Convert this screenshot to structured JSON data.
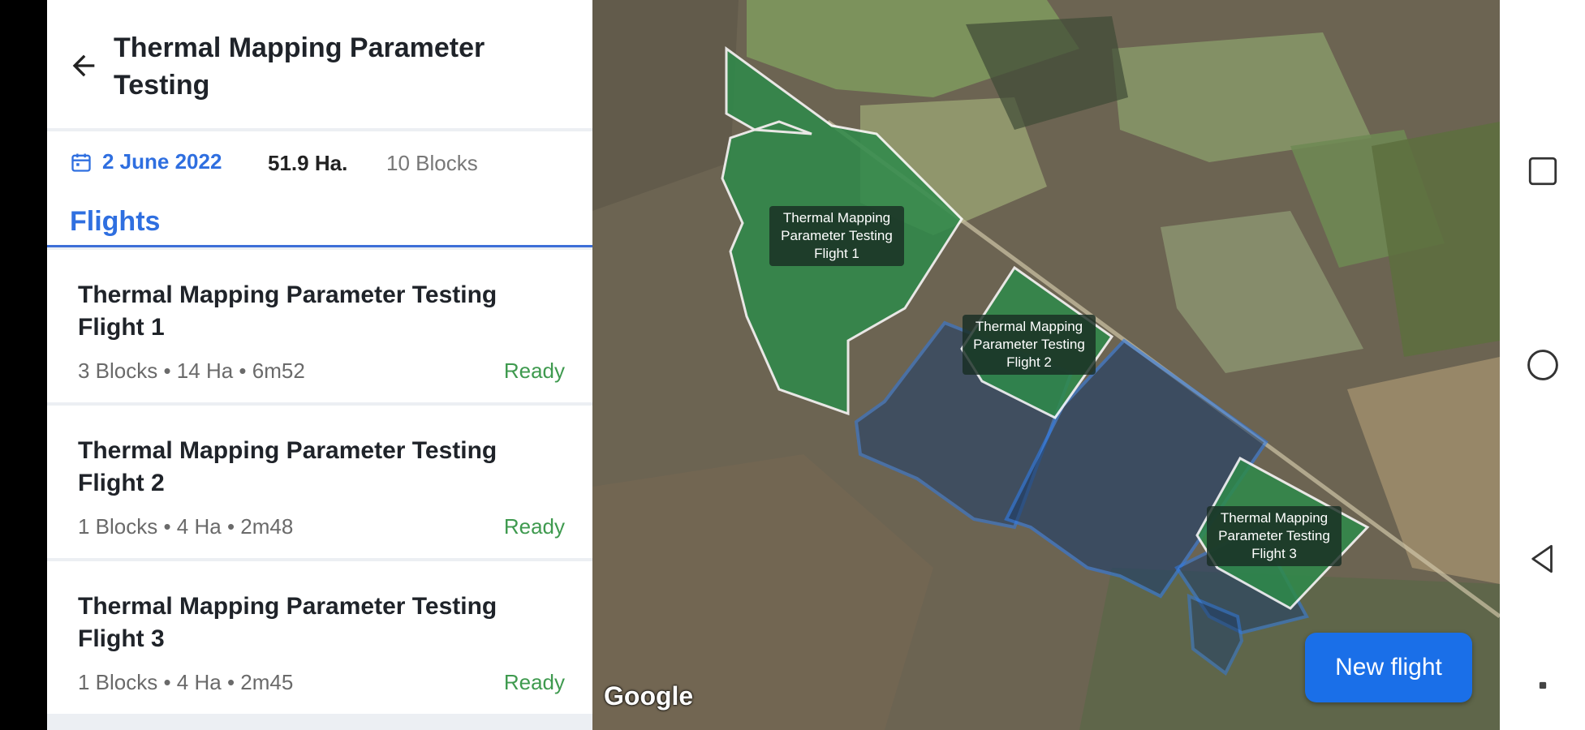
{
  "header": {
    "title": "Thermal Mapping Parameter Testing"
  },
  "info": {
    "date": "2 June 2022",
    "area": "51.9 Ha.",
    "blocks": "10 Blocks"
  },
  "flights_heading": "Flights",
  "flights": [
    {
      "name": "Thermal Mapping Parameter Testing Flight 1",
      "meta": "3 Blocks • 14 Ha • 6m52",
      "status": "Ready"
    },
    {
      "name": "Thermal Mapping Parameter Testing Flight 2",
      "meta": "1 Blocks • 4 Ha • 2m48",
      "status": "Ready"
    },
    {
      "name": "Thermal Mapping Parameter Testing Flight 3",
      "meta": "1 Blocks • 4 Ha • 2m45",
      "status": "Ready"
    }
  ],
  "map": {
    "labels": [
      "Thermal Mapping Parameter Testing Flight 1",
      "Thermal Mapping Parameter Testing Flight 2",
      "Thermal Mapping Parameter Testing Flight 3"
    ],
    "new_flight": "New flight",
    "attribution": "Google"
  },
  "colors": {
    "accent": "#2f6fe0",
    "ready": "#3f9a4f",
    "button": "#1a6fe8",
    "field_green": "#2e8a4a",
    "selection_blue": "#2f7be8"
  },
  "icons": {
    "back": "arrow-back-icon",
    "date": "calendar-icon",
    "nav": [
      "recents-icon",
      "home-icon",
      "back-triangle-icon",
      "dot-icon"
    ]
  }
}
